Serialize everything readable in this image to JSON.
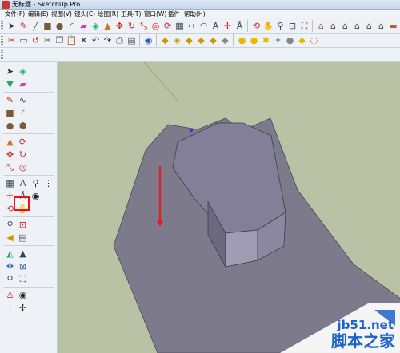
{
  "window": {
    "title": "无标题 - SketchUp Pro"
  },
  "menubar": {
    "items": [
      {
        "label": "文件(F)"
      },
      {
        "label": "编辑(E)"
      },
      {
        "label": "视图(V)"
      },
      {
        "label": "镜头(C)"
      },
      {
        "label": "绘图(R)"
      },
      {
        "label": "工具(T)"
      },
      {
        "label": "窗口(W)"
      },
      {
        "label": "插件"
      },
      {
        "label": "帮助(H)"
      }
    ]
  },
  "toolbars": {
    "row1_icons": [
      "select-icon",
      "pencil-icon",
      "line-icon",
      "rectangle-icon",
      "circle-icon",
      "arc-icon",
      "eraser-icon",
      "paint-bucket-icon",
      "push-pull-icon",
      "move-icon",
      "rotate-icon",
      "scale-icon",
      "offset-icon",
      "follow-me-icon",
      "tape-measure-icon",
      "dimension-icon",
      "protractor-icon",
      "text-icon",
      "axes-icon",
      "3d-text-icon",
      "orbit-icon",
      "pan-icon",
      "zoom-icon",
      "zoom-window-icon",
      "zoom-extents-icon",
      "previous-view-icon",
      "next-view-icon",
      "iso-view-icon",
      "top-view-icon",
      "front-view-icon",
      "right-view-icon",
      "back-view-icon",
      "left-view-icon"
    ],
    "row2_icons": [
      "make-component-icon",
      "make-group-icon",
      "rotate-tool-icon",
      "cut-icon",
      "copy-icon",
      "paste-icon",
      "delete-icon",
      "undo-icon",
      "redo-icon",
      "print-icon",
      "model-info-icon",
      "xray-icon",
      "back-edges-icon",
      "wireframe-icon",
      "hidden-line-icon",
      "shaded-icon",
      "shaded-texture-icon",
      "monochrome-icon",
      "shadows-icon",
      "fog-icon",
      "sun-icon",
      "section-plane-icon",
      "rainbow-icon"
    ]
  },
  "left_toolbar": {
    "highlighted_tool": "push-pull-icon"
  },
  "viewport": {
    "background": "#b9c2a5",
    "face_color": "#7d7a8c",
    "annotation_color": "#e02020"
  },
  "watermark": {
    "site": "jb51.net",
    "name": "脚本之家"
  }
}
